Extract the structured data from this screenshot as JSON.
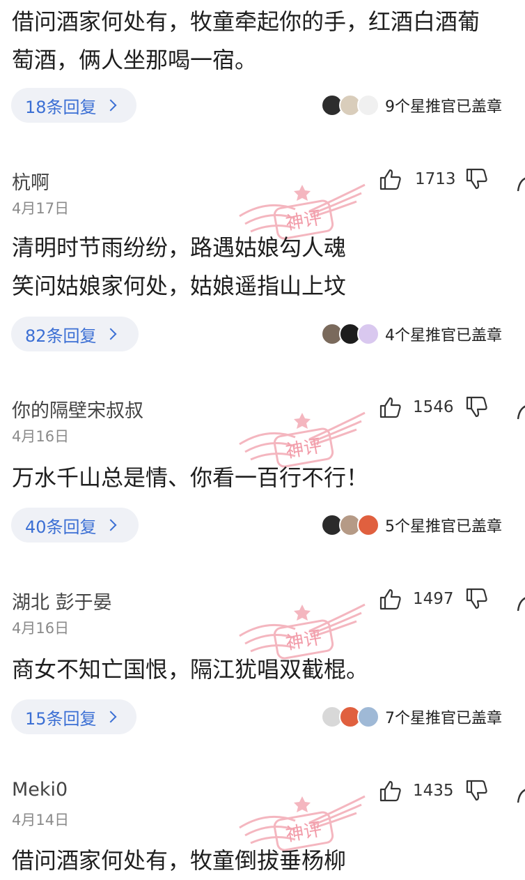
{
  "top_comment": {
    "text_line1": "借问酒家何处有，牧童牵起你的手，红酒白酒葡",
    "text_line2": "萄酒，俩人坐那喝一宿。",
    "reply_label": "18条回复",
    "star_text": "9个星推官已盖章"
  },
  "comments": [
    {
      "username": "杭啊",
      "date": "4月17日",
      "likes": "1713",
      "text_lines": [
        "清明时节雨纷纷，路遇姑娘勾人魂",
        "笑问姑娘家何处，姑娘遥指山上坟"
      ],
      "reply_label": "82条回复",
      "star_text": "4个星推官已盖章"
    },
    {
      "username": "你的隔壁宋叔叔",
      "date": "4月16日",
      "likes": "1546",
      "text_lines": [
        "万水千山总是情、你看一百行不行！"
      ],
      "reply_label": "40条回复",
      "star_text": "5个星推官已盖章"
    },
    {
      "username": "湖北 彭于晏",
      "date": "4月16日",
      "likes": "1497",
      "text_lines": [
        "商女不知亡国恨，隔江犹唱双截棍。"
      ],
      "reply_label": "15条回复",
      "star_text": "7个星推官已盖章"
    },
    {
      "username": "Meki0",
      "date": "4月14日",
      "likes": "1435",
      "text_lines": [
        "借问酒家何处有，牧童倒拔垂杨柳"
      ]
    }
  ],
  "watermark_text": "神评",
  "icons": {
    "like": "thumbs-up-icon",
    "dislike": "thumbs-down-icon",
    "share": "share-icon",
    "chevron": "chevron-right-icon"
  },
  "colors": {
    "reply_text": "#3b6fd4",
    "reply_bg": "#eff1f6",
    "watermark": "#f3aab5"
  }
}
